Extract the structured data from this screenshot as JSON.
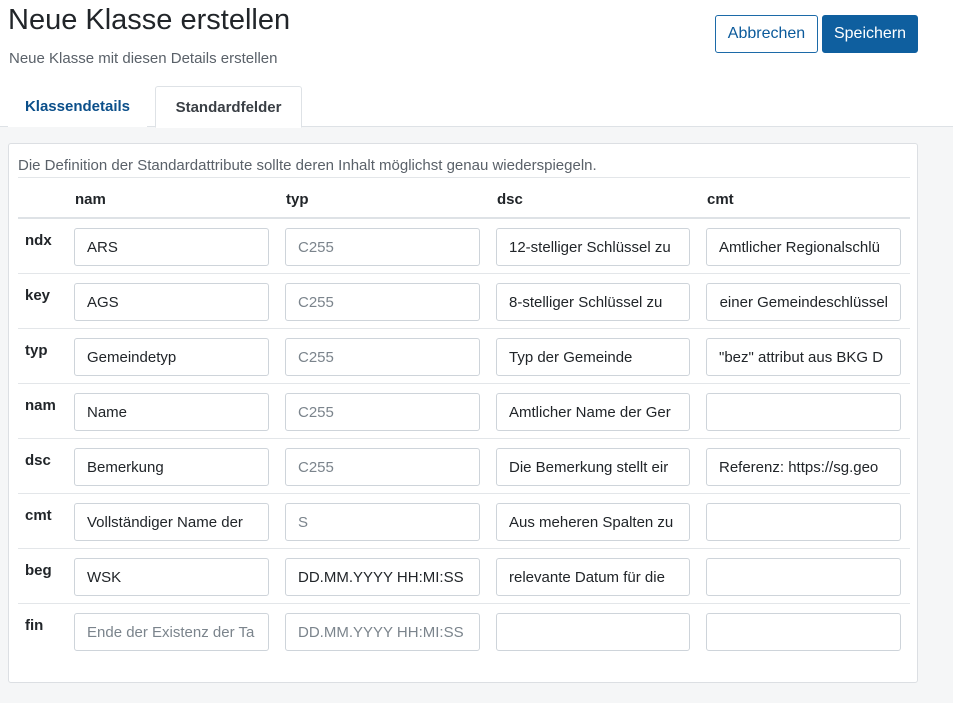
{
  "header": {
    "title": "Neue Klasse erstellen",
    "subtitle": "Neue Klasse mit diesen Details erstellen",
    "cancel_label": "Abbrechen",
    "save_label": "Speichern"
  },
  "tabs": [
    {
      "label": "Klassendetails",
      "active": false
    },
    {
      "label": "Standardfelder",
      "active": true
    }
  ],
  "panel": {
    "description": "Die Definition der Standardattribute sollte deren Inhalt möglichst genau wiederspiegeln.",
    "columns": [
      "nam",
      "typ",
      "dsc",
      "cmt"
    ],
    "rows": [
      {
        "key": "ndx",
        "nam": {
          "value": "ARS",
          "placeholder": ""
        },
        "typ": {
          "value": "",
          "placeholder": "C255"
        },
        "dsc": {
          "value": "12-stelliger Schlüssel zu",
          "placeholder": ""
        },
        "cmt": {
          "value": "Amtlicher Regionalschlü",
          "placeholder": ""
        }
      },
      {
        "key": "key",
        "nam": {
          "value": "AGS",
          "placeholder": ""
        },
        "typ": {
          "value": "",
          "placeholder": "C255"
        },
        "dsc": {
          "value": "8-stelliger Schlüssel zu",
          "placeholder": ""
        },
        "cmt": {
          "value": "einer Gemeindeschlüssel",
          "placeholder": ""
        }
      },
      {
        "key": "typ",
        "nam": {
          "value": "Gemeindetyp",
          "placeholder": ""
        },
        "typ": {
          "value": "",
          "placeholder": "C255"
        },
        "dsc": {
          "value": "Typ der Gemeinde",
          "placeholder": ""
        },
        "cmt": {
          "value": "\"bez\" attribut aus BKG D",
          "placeholder": ""
        }
      },
      {
        "key": "nam",
        "nam": {
          "value": "Name",
          "placeholder": ""
        },
        "typ": {
          "value": "",
          "placeholder": "C255"
        },
        "dsc": {
          "value": "Amtlicher Name der Ger",
          "placeholder": ""
        },
        "cmt": {
          "value": "",
          "placeholder": ""
        }
      },
      {
        "key": "dsc",
        "nam": {
          "value": "Bemerkung",
          "placeholder": ""
        },
        "typ": {
          "value": "",
          "placeholder": "C255"
        },
        "dsc": {
          "value": "Die Bemerkung stellt eir",
          "placeholder": ""
        },
        "cmt": {
          "value": "Referenz: https://sg.geo",
          "placeholder": ""
        }
      },
      {
        "key": "cmt",
        "nam": {
          "value": "Vollständiger Name der",
          "placeholder": ""
        },
        "typ": {
          "value": "",
          "placeholder": "S"
        },
        "dsc": {
          "value": "Aus meheren Spalten zu",
          "placeholder": ""
        },
        "cmt": {
          "value": "",
          "placeholder": ""
        }
      },
      {
        "key": "beg",
        "nam": {
          "value": "WSK",
          "placeholder": ""
        },
        "typ": {
          "value": "DD.MM.YYYY HH:MI:SS",
          "placeholder": ""
        },
        "dsc": {
          "value": "relevante Datum für die",
          "placeholder": ""
        },
        "cmt": {
          "value": "",
          "placeholder": ""
        }
      },
      {
        "key": "fin",
        "nam": {
          "value": "",
          "placeholder": "Ende der Existenz der Ta"
        },
        "typ": {
          "value": "",
          "placeholder": "DD.MM.YYYY HH:MI:SS"
        },
        "dsc": {
          "value": "",
          "placeholder": ""
        },
        "cmt": {
          "value": "",
          "placeholder": ""
        }
      }
    ]
  },
  "colors": {
    "accent": "#0f5f9f",
    "tab_link": "#0b4f8a",
    "border": "#ced4da",
    "page_bg": "#f5f6f7"
  }
}
